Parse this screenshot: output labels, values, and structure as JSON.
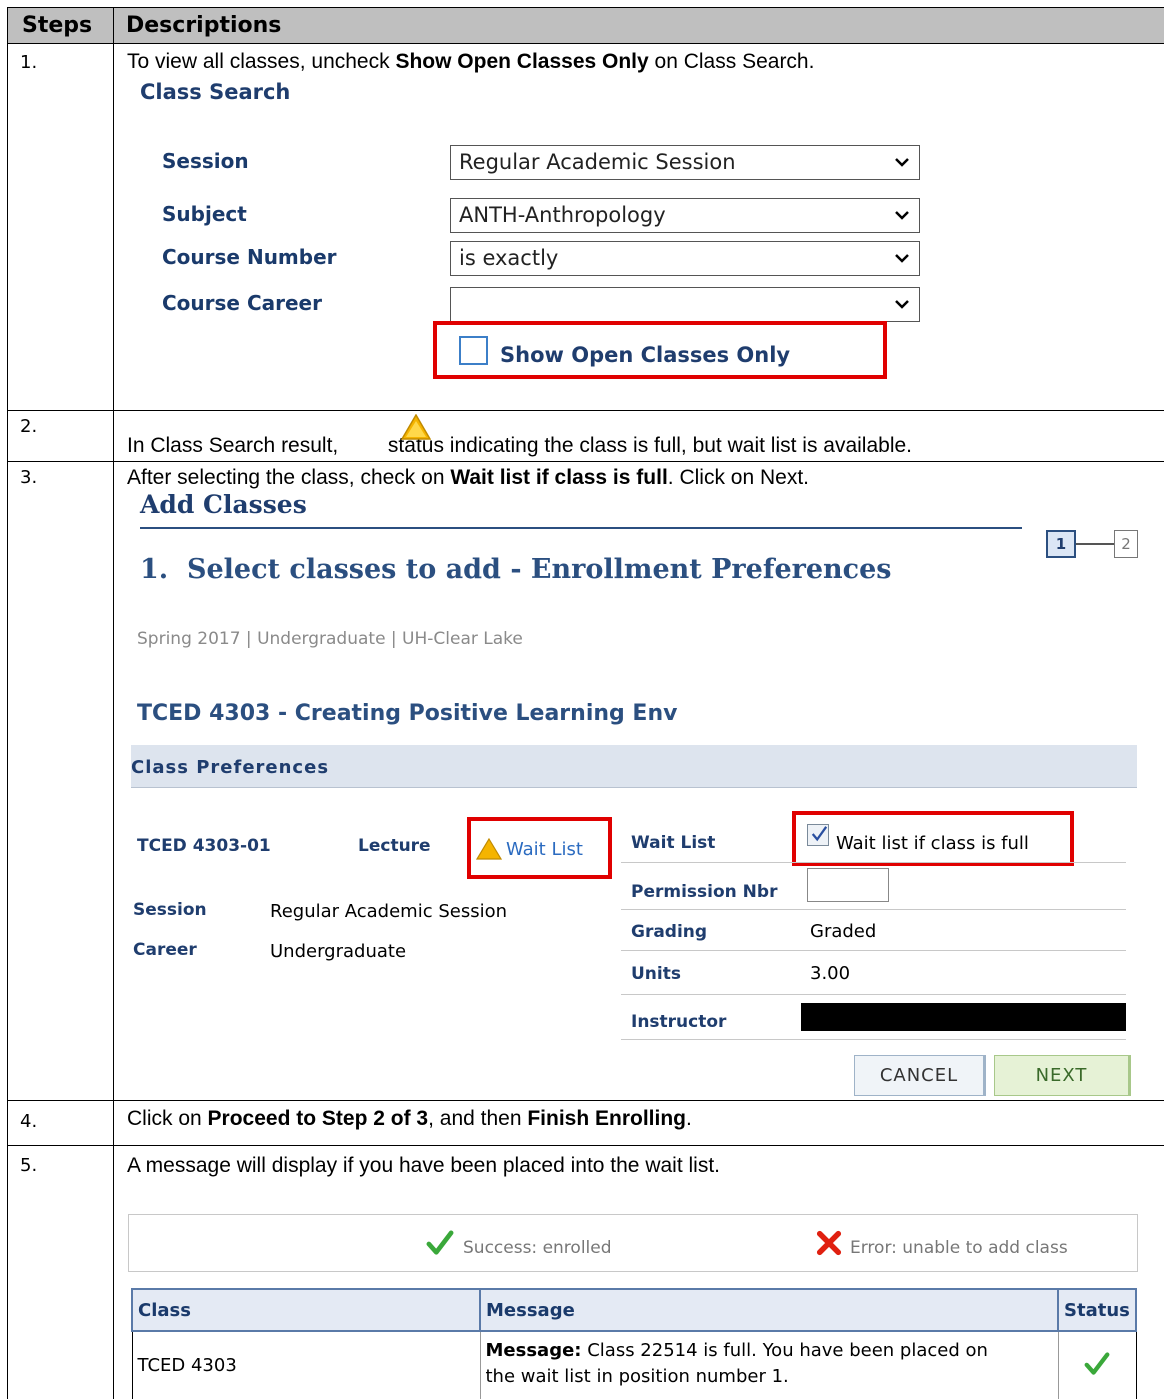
{
  "header": {
    "steps": "Steps",
    "descriptions": "Descriptions"
  },
  "rows": [
    {
      "num": "1.",
      "pre": "To view all classes, uncheck ",
      "bold": "Show Open Classes Only",
      "post": " on Class Search."
    },
    {
      "num": "2.",
      "pre": "In Class Search result, ",
      "post": " status indicating the class is full, but wait list is available."
    },
    {
      "num": "3.",
      "pre": "After selecting the class, check on ",
      "bold": "Wait list if class is full",
      "post": ". Click on Next."
    },
    {
      "num": "4.",
      "pre": "Click on ",
      "bold": "Proceed to Step 2 of 3",
      "mid": ", and then ",
      "bold2": "Finish Enrolling",
      "post": "."
    },
    {
      "num": "5.",
      "text": "A message will display if you have been placed into the wait list."
    }
  ],
  "class_search": {
    "title": "Class Search",
    "fields": [
      {
        "label": "Session",
        "value": "Regular Academic Session"
      },
      {
        "label": "Subject",
        "value": "ANTH-Anthropology"
      },
      {
        "label": "Course Number",
        "value": "is exactly"
      },
      {
        "label": "Course Career",
        "value": ""
      }
    ],
    "checkbox_label": "Show Open Classes Only"
  },
  "add_classes": {
    "title": "Add Classes",
    "step_title": "1.  Select classes to add - Enrollment Preferences",
    "steps": [
      "1",
      "2"
    ],
    "term_line": "Spring 2017 | Undergraduate | UH-Clear Lake",
    "course_title": "TCED 4303 - Creating Positive Learning Env",
    "section_header": "Class Preferences",
    "section": "TCED 4303-01",
    "component": "Lecture",
    "status": "Wait List",
    "session_label": "Session",
    "session_value": "Regular Academic Session",
    "career_label": "Career",
    "career_value": "Undergraduate",
    "wait_list_label": "Wait List",
    "wait_list_checkbox": "Wait list if class is full",
    "permission_label": "Permission Nbr",
    "grading_label": "Grading",
    "grading_value": "Graded",
    "units_label": "Units",
    "units_value": "3.00",
    "instructor_label": "Instructor",
    "cancel": "CANCEL",
    "next": "NEXT"
  },
  "results": {
    "legend_success": "Success: enrolled",
    "legend_error": "Error: unable to add class",
    "col_class": "Class",
    "col_message": "Message",
    "col_status": "Status",
    "row_class": "TCED 4303",
    "msg_label": "Message:",
    "msg_line1": " Class 22514 is full. You have been placed on",
    "msg_line2": "the wait list in position number 1."
  },
  "colors": {
    "accent_red": "#e00000",
    "navy": "#1a3a6b",
    "warning": "#f5b400",
    "success": "#3aa83a"
  }
}
